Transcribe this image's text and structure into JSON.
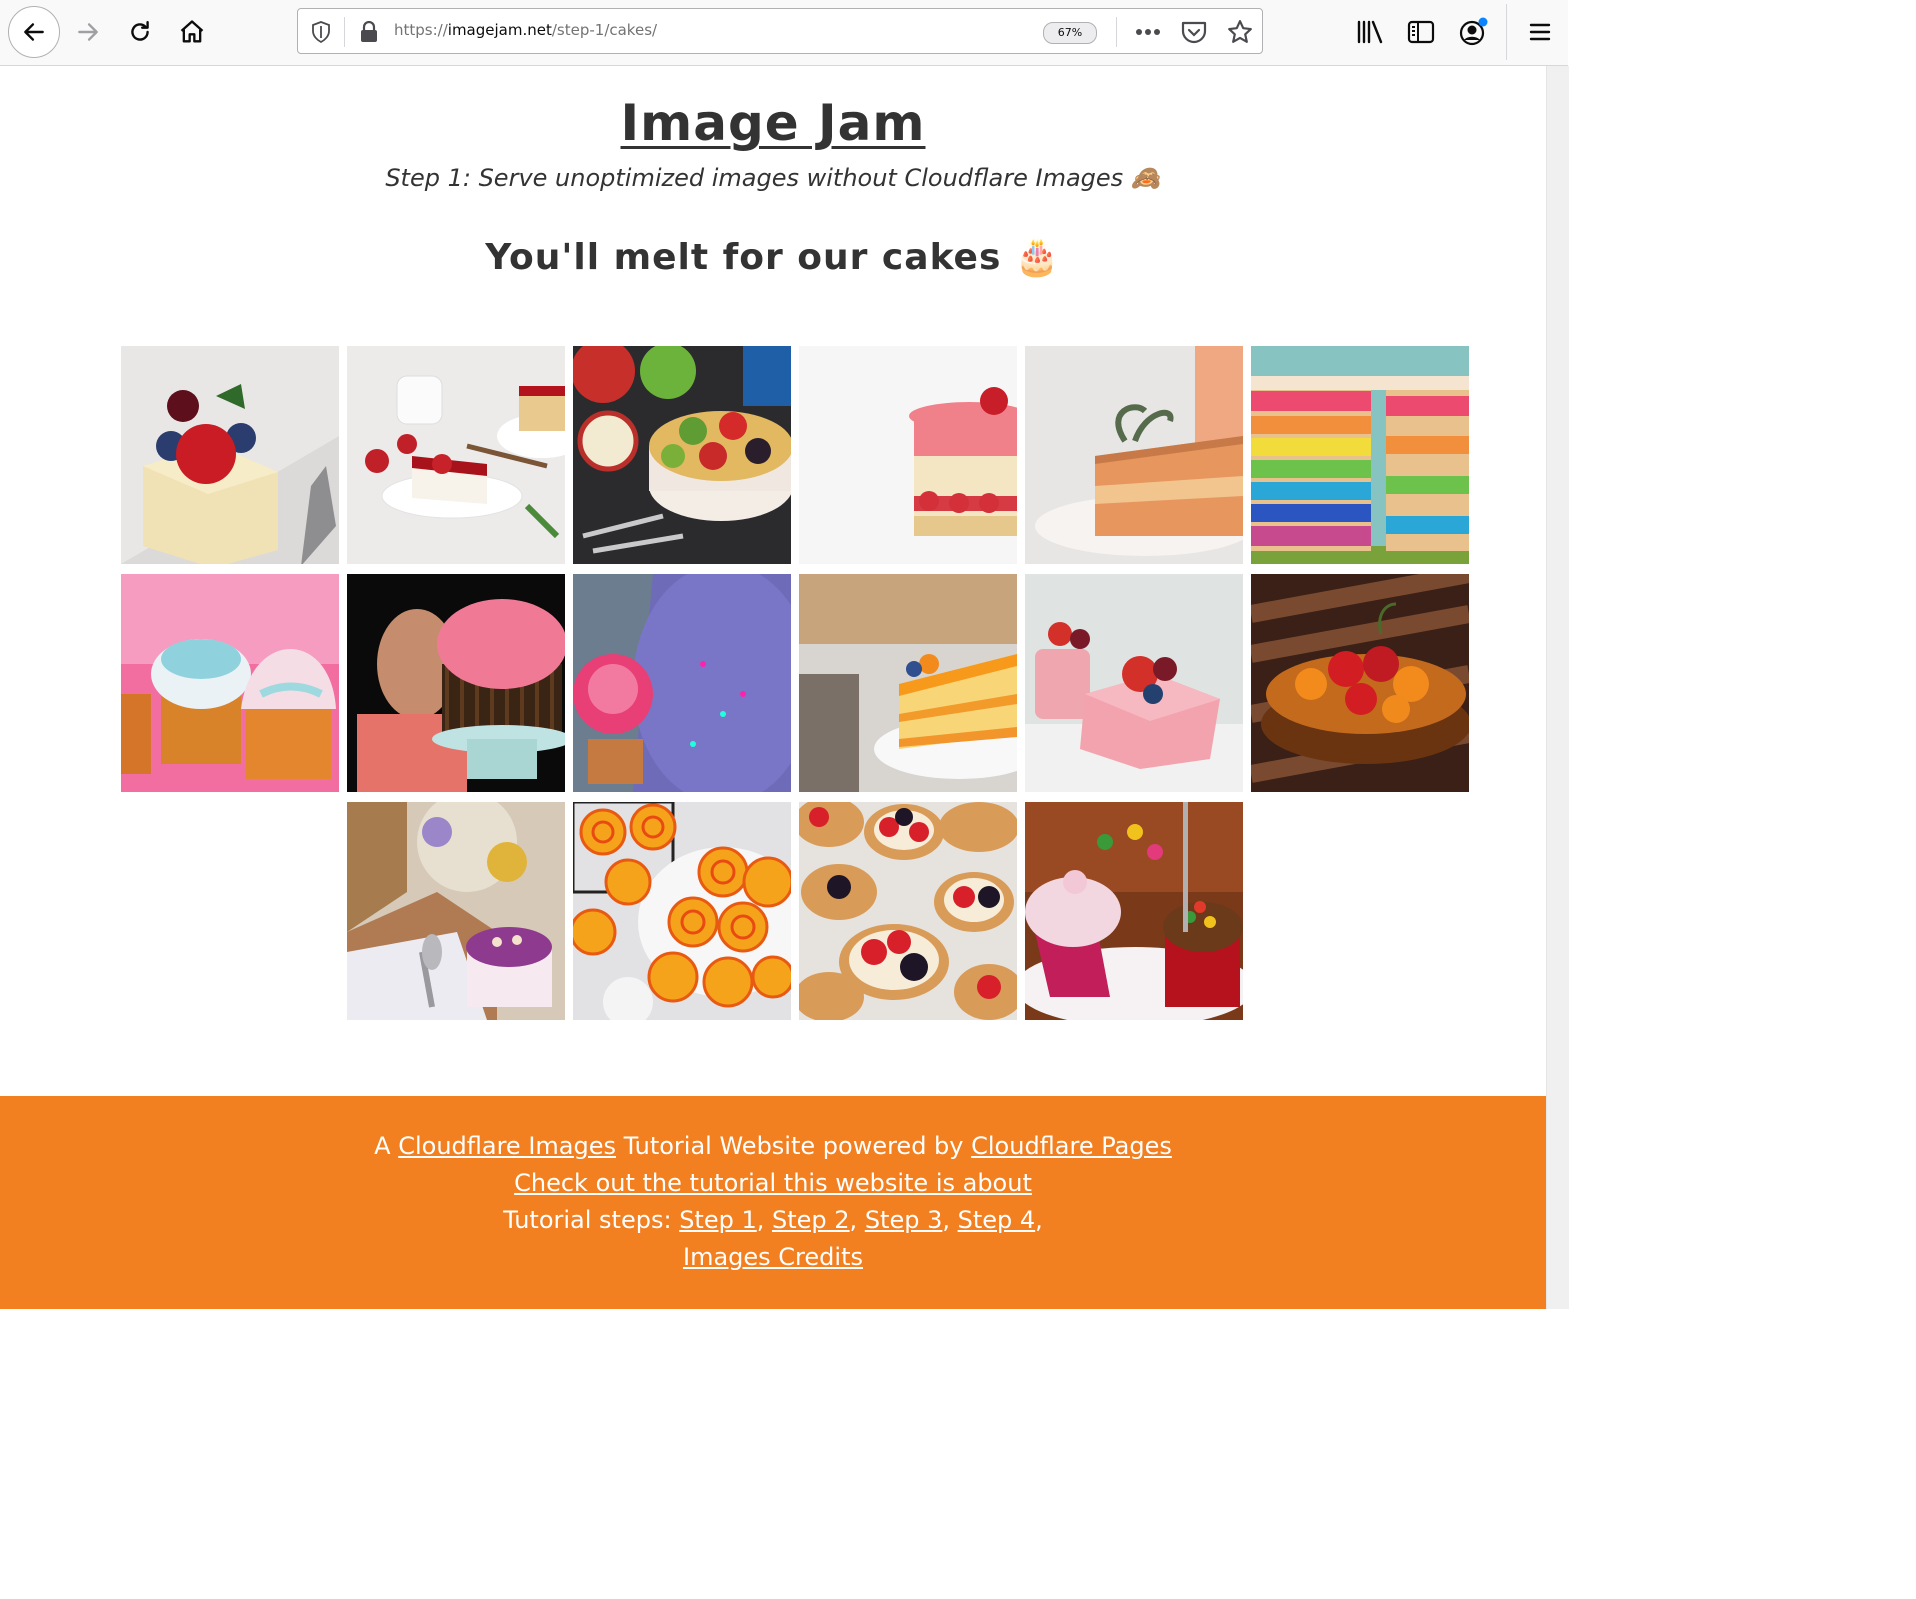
{
  "browser": {
    "url_prefix": "https://",
    "url_domain": "imagejam.net",
    "url_path": "/step-1/cakes/",
    "zoom": "67%",
    "icons": [
      "back-arrow-icon",
      "forward-arrow-icon",
      "reload-icon",
      "home-icon",
      "shield-icon",
      "lock-icon",
      "more-icon",
      "pocket-icon",
      "star-icon",
      "library-icon",
      "sidebar-icon",
      "account-icon",
      "menu-icon"
    ]
  },
  "header": {
    "title": "Image Jam",
    "subtitle": "Step 1: Serve unoptimized images without Cloudflare Images 🙈"
  },
  "section": {
    "title": "You'll melt for our cakes 🎂"
  },
  "gallery": {
    "tiles": [
      {
        "name": "cake-photo-1"
      },
      {
        "name": "cake-photo-2"
      },
      {
        "name": "cake-photo-3"
      },
      {
        "name": "cake-photo-4"
      },
      {
        "name": "cake-photo-5"
      },
      {
        "name": "cake-photo-6"
      },
      {
        "name": "cake-photo-7"
      },
      {
        "name": "cake-photo-8"
      },
      {
        "name": "cake-photo-9"
      },
      {
        "name": "cake-photo-10"
      },
      {
        "name": "cake-photo-11"
      },
      {
        "name": "cake-photo-12"
      },
      {
        "name": "cake-photo-13"
      },
      {
        "name": "cake-photo-14"
      },
      {
        "name": "cake-photo-15"
      },
      {
        "name": "cake-photo-16"
      }
    ]
  },
  "footer": {
    "line1_prefix": "A ",
    "link_images": "Cloudflare Images",
    "line1_middle": " Tutorial Website powered by ",
    "link_pages": "Cloudflare Pages",
    "link_tutorial": "Check out the tutorial this website is about",
    "steps_prefix": "Tutorial steps: ",
    "step1": "Step 1",
    "step2": "Step 2",
    "step3": "Step 3",
    "step4": "Step 4",
    "credits": "Images Credits",
    "bg_color": "#f38020"
  }
}
